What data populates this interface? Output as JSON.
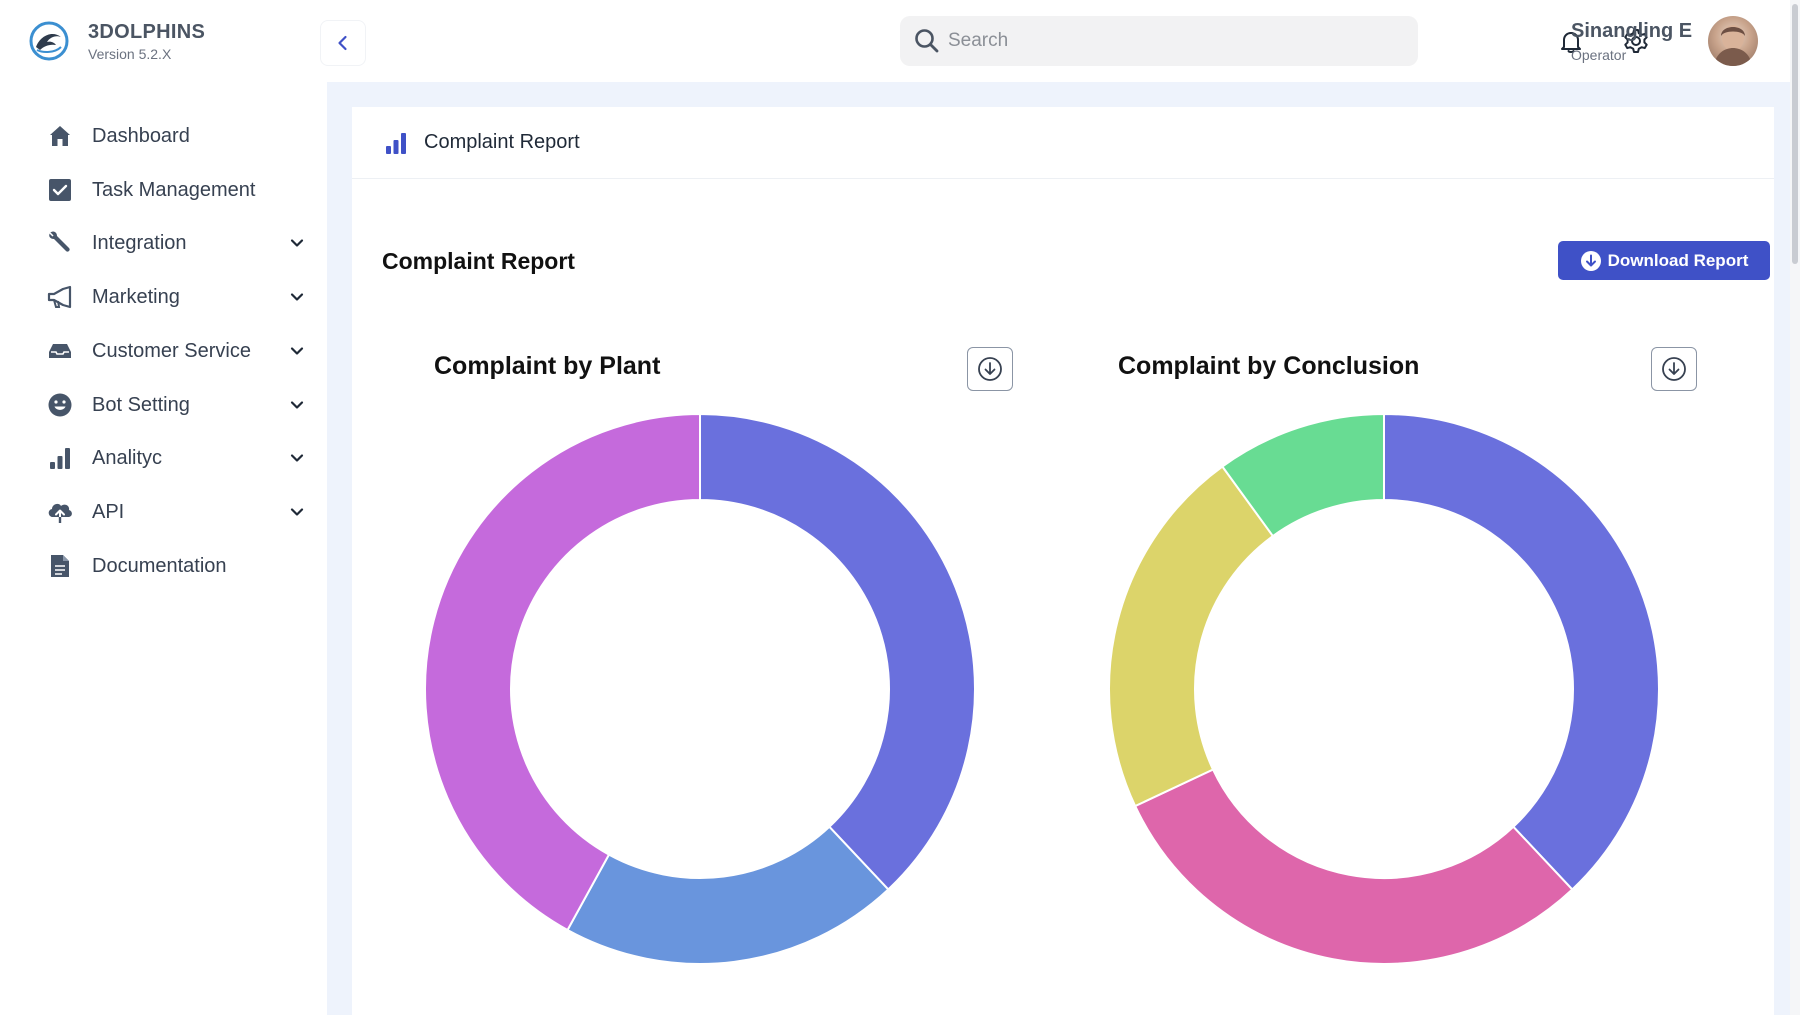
{
  "brand": {
    "name": "3DOLPHINS",
    "version": "Version 5.2.X"
  },
  "search": {
    "placeholder": "Search"
  },
  "user": {
    "name": "Sinangling E",
    "role": "Operator"
  },
  "sidebar": {
    "items": [
      {
        "label": "Dashboard",
        "icon": "home-icon",
        "expandable": false
      },
      {
        "label": "Task Management",
        "icon": "checkbox-icon",
        "expandable": false
      },
      {
        "label": "Integration",
        "icon": "wrench-icon",
        "expandable": true
      },
      {
        "label": "Marketing",
        "icon": "megaphone-icon",
        "expandable": true
      },
      {
        "label": "Customer Service",
        "icon": "inbox-icon",
        "expandable": true
      },
      {
        "label": "Bot Setting",
        "icon": "smiley-icon",
        "expandable": true
      },
      {
        "label": "Analityc",
        "icon": "bar-chart-icon",
        "expandable": true
      },
      {
        "label": "API",
        "icon": "cloud-upload-icon",
        "expandable": true
      },
      {
        "label": "Documentation",
        "icon": "document-icon",
        "expandable": false
      }
    ]
  },
  "page": {
    "header_title": "Complaint Report",
    "section_title": "Complaint Report",
    "download_label": "Download Report"
  },
  "colors": {
    "accent": "#3f51c7",
    "sidebar_icon": "#475569",
    "main_bg": "#eef3fc"
  },
  "chart_data": [
    {
      "type": "pie",
      "title": "Complaint by Plant",
      "donut": true,
      "values": [
        38,
        20,
        42
      ],
      "colors": [
        "#6a70dd",
        "#6995dd",
        "#c56adc"
      ]
    },
    {
      "type": "pie",
      "title": "Complaint by Conclusion",
      "donut": true,
      "values": [
        38,
        30,
        22,
        10
      ],
      "colors": [
        "#6a70dd",
        "#de66ab",
        "#dcd46a",
        "#68dc93"
      ]
    }
  ]
}
